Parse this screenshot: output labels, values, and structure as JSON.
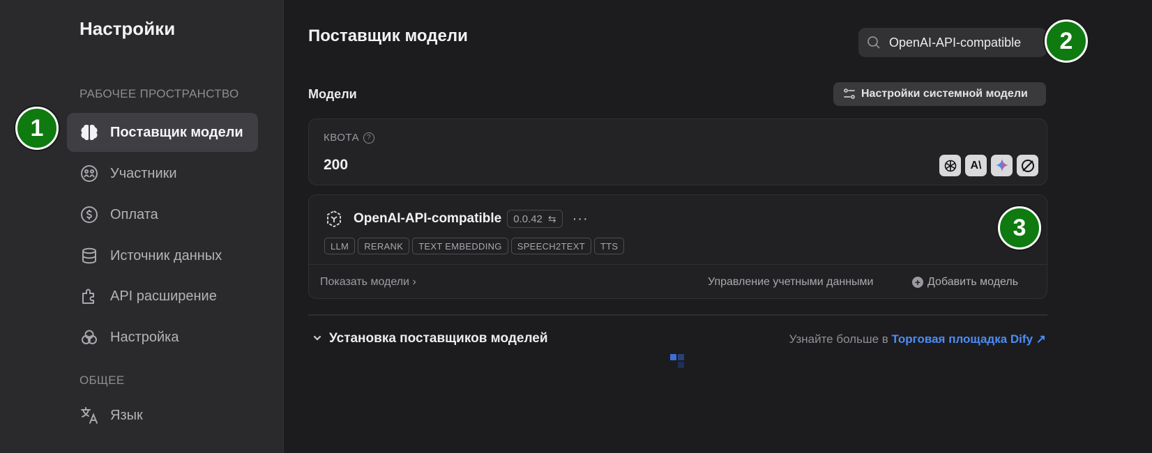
{
  "sidebar": {
    "title": "Настройки",
    "group_workspace": "РАБОЧЕЕ ПРОСТРАНСТВО",
    "group_general": "ОБЩЕЕ",
    "items": [
      {
        "label": "Поставщик модели",
        "icon": "brain-icon",
        "active": true
      },
      {
        "label": "Участники",
        "icon": "members-icon"
      },
      {
        "label": "Оплата",
        "icon": "billing-icon"
      },
      {
        "label": "Источник данных",
        "icon": "database-icon"
      },
      {
        "label": "API расширение",
        "icon": "puzzle-icon"
      },
      {
        "label": "Настройка",
        "icon": "customization-icon"
      }
    ],
    "general_items": [
      {
        "label": "Язык",
        "icon": "language-icon"
      }
    ]
  },
  "markers": [
    "1",
    "2",
    "3"
  ],
  "main": {
    "title": "Поставщик модели",
    "search": {
      "value": "OpenAI-API-compatible",
      "icon": "search-icon"
    },
    "models_label": "Модели",
    "system_model_button": "Настройки системной модели",
    "quota": {
      "label": "КВОТА",
      "help_icon": "question-icon",
      "value": "200",
      "provider_icons": [
        "openai-icon",
        "anthropic-icon",
        "gemini-icon",
        "other-provider-icon"
      ]
    },
    "provider": {
      "name": "OpenAI-API-compatible",
      "version": "0.0.42",
      "tags": [
        "LLM",
        "RERANK",
        "TEXT EMBEDDING",
        "SPEECH2TEXT",
        "TTS"
      ],
      "show_models": "Показать модели",
      "manage_credentials": "Управление учетными данными",
      "add_model": "Добавить модель"
    },
    "install": {
      "title": "Установка поставщиков моделей",
      "learn_more_prefix": "Узнайте больше в",
      "marketplace_link": "Торговая площадка Dify"
    }
  },
  "colors": {
    "marker_green": "#0e7a10",
    "link_blue": "#4b8df7",
    "active_item_bg": "#3f3f43"
  }
}
